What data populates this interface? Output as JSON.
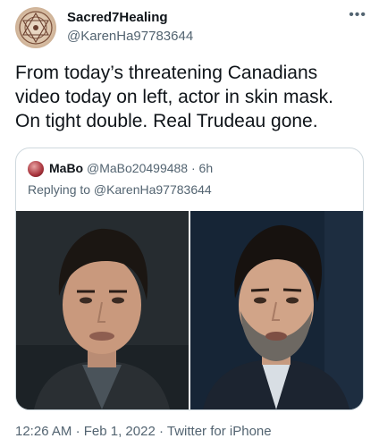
{
  "author": {
    "name": "Sacred7Healing",
    "handle": "@KarenHa97783644"
  },
  "tweet": {
    "text": "From today’s threatening Canadians\nvideo today on left, actor in skin mask.\nOn tight double.  Real Trudeau gone."
  },
  "more_icon": "•••",
  "quoted": {
    "name": "MaBo",
    "handle": "@MaBo20499488",
    "separator": "·",
    "time": "6h",
    "reply_text": "Replying to @KarenHa97783644"
  },
  "photos": [
    {
      "icon": "photo-left",
      "bg": "#20272b"
    },
    {
      "icon": "photo-right",
      "bg": "#152335"
    }
  ],
  "footer": {
    "time": "12:26 AM",
    "date": "Feb 1, 2022",
    "client": "Twitter for iPhone",
    "separator": "·"
  }
}
